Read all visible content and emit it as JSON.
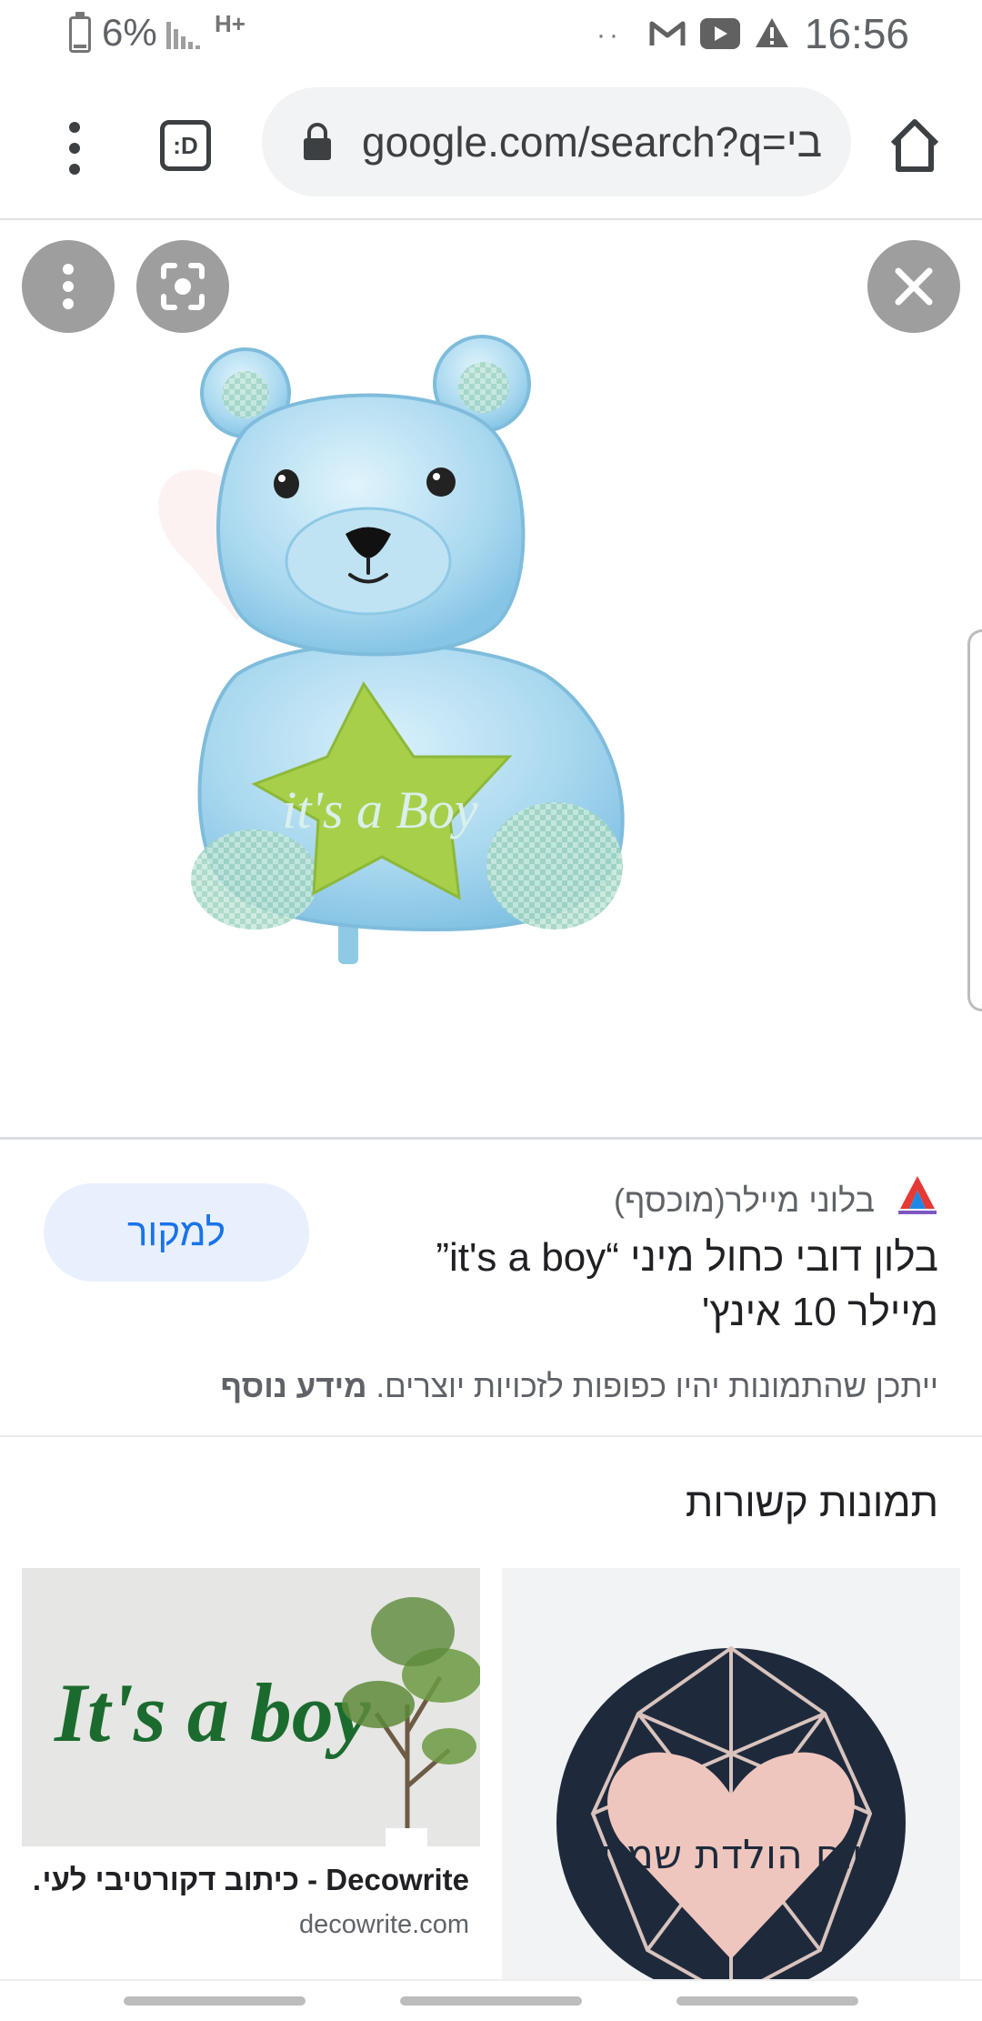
{
  "status_bar": {
    "battery": "6%",
    "network": "H+",
    "time": "16:56",
    "dots": "··"
  },
  "browser": {
    "tabs_label": ":D",
    "url": "google.com/search?q=בי",
    "icons": [
      "menu-kebab-icon",
      "tabs-icon",
      "lock-icon",
      "home-icon"
    ]
  },
  "viewer": {
    "buttons": [
      "more-options",
      "lens-search",
      "close"
    ],
    "image_text": "it's a Boy",
    "colors": {
      "balloon": "#a9d8ef",
      "star": "#a7cf4a"
    }
  },
  "result": {
    "source_name": "בלוני מיילר(מוכסף)",
    "visit_label": "למקור",
    "title": "בלון דובי כחול מיני “it's a boy” מיילר 10 אינץ'",
    "copyright_text": "ייתכן שהתמונות יהיו כפופות לזכויות יוצרים.",
    "learn_more": "מידע נוסף"
  },
  "related": {
    "heading": "תמונות קשורות",
    "cards": [
      {
        "image_text": "It's a boy",
        "caption": "Decowrite - כיתוב דקורטיבי לעי…",
        "domain": "decowrite.com"
      },
      {
        "image_text": "יום הולדת שמח"
      }
    ]
  }
}
